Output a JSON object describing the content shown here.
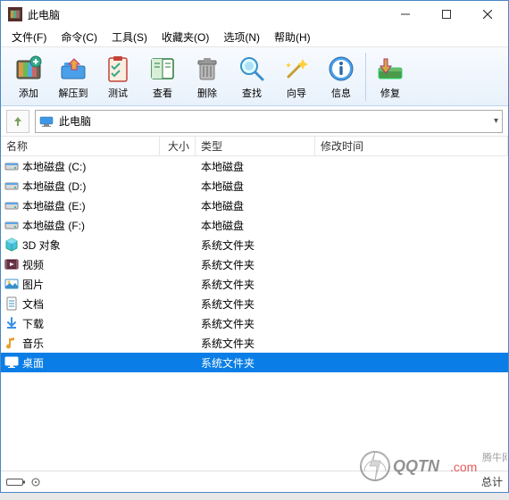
{
  "title": "此电脑",
  "menus": [
    "文件(F)",
    "命令(C)",
    "工具(S)",
    "收藏夹(O)",
    "选项(N)",
    "帮助(H)"
  ],
  "toolbar": [
    {
      "id": "add",
      "label": "添加"
    },
    {
      "id": "extract",
      "label": "解压到"
    },
    {
      "id": "test",
      "label": "测试"
    },
    {
      "id": "view",
      "label": "查看"
    },
    {
      "id": "delete",
      "label": "删除"
    },
    {
      "id": "find",
      "label": "查找"
    },
    {
      "id": "wizard",
      "label": "向导"
    },
    {
      "id": "info",
      "label": "信息"
    },
    {
      "id": "repair",
      "label": "修复"
    }
  ],
  "address": "此电脑",
  "columns": {
    "name": "名称",
    "size": "大小",
    "type": "类型",
    "mtime": "修改时间"
  },
  "rows": [
    {
      "icon": "drive",
      "name": "本地磁盘 (C:)",
      "type": "本地磁盘",
      "selected": false
    },
    {
      "icon": "drive",
      "name": "本地磁盘 (D:)",
      "type": "本地磁盘",
      "selected": false
    },
    {
      "icon": "drive",
      "name": "本地磁盘 (E:)",
      "type": "本地磁盘",
      "selected": false
    },
    {
      "icon": "drive",
      "name": "本地磁盘 (F:)",
      "type": "本地磁盘",
      "selected": false
    },
    {
      "icon": "objects3d",
      "name": "3D 对象",
      "type": "系统文件夹",
      "selected": false
    },
    {
      "icon": "videos",
      "name": "视频",
      "type": "系统文件夹",
      "selected": false
    },
    {
      "icon": "pictures",
      "name": "图片",
      "type": "系统文件夹",
      "selected": false
    },
    {
      "icon": "documents",
      "name": "文档",
      "type": "系统文件夹",
      "selected": false
    },
    {
      "icon": "downloads",
      "name": "下载",
      "type": "系统文件夹",
      "selected": false
    },
    {
      "icon": "music",
      "name": "音乐",
      "type": "系统文件夹",
      "selected": false
    },
    {
      "icon": "desktop",
      "name": "桌面",
      "type": "系统文件夹",
      "selected": true
    }
  ],
  "status": {
    "left": "",
    "right": "总计"
  }
}
